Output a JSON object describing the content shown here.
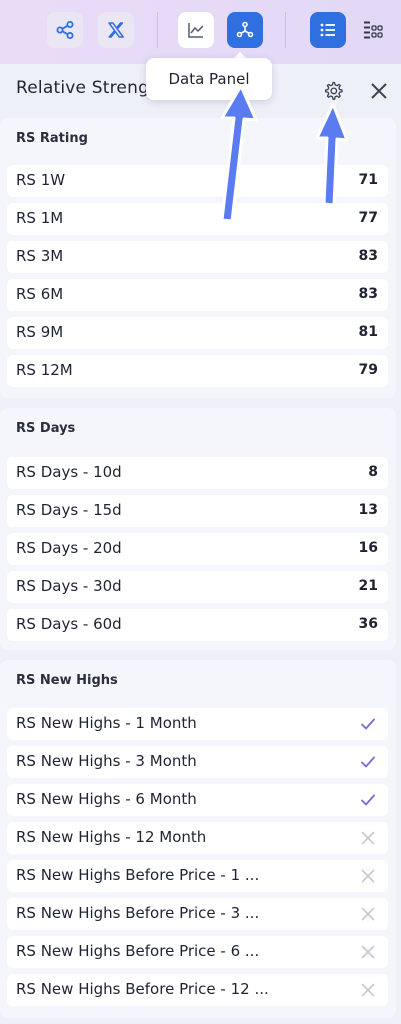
{
  "toolbar": {
    "buttons": [
      {
        "icon": "share-icon"
      },
      {
        "icon": "x-logo-icon"
      },
      {
        "icon": "line-chart-icon"
      },
      {
        "icon": "data-panel-icon",
        "active": true
      },
      {
        "icon": "list-view-icon",
        "active": true
      },
      {
        "icon": "grid-view-icon"
      }
    ]
  },
  "tooltip": "Data Panel",
  "panel": {
    "title": "Relative Streng",
    "settings_icon": "gear-icon",
    "close_icon": "close-icon"
  },
  "sections": {
    "rating": {
      "title": "RS Rating",
      "rows": [
        {
          "label": "RS 1W",
          "value": "71"
        },
        {
          "label": "RS 1M",
          "value": "77"
        },
        {
          "label": "RS 3M",
          "value": "83"
        },
        {
          "label": "RS 6M",
          "value": "83"
        },
        {
          "label": "RS 9M",
          "value": "81"
        },
        {
          "label": "RS 12M",
          "value": "79"
        }
      ]
    },
    "days": {
      "title": "RS Days",
      "rows": [
        {
          "label": "RS Days - 10d",
          "value": "8"
        },
        {
          "label": "RS Days - 15d",
          "value": "13"
        },
        {
          "label": "RS Days - 20d",
          "value": "16"
        },
        {
          "label": "RS Days - 30d",
          "value": "21"
        },
        {
          "label": "RS Days - 60d",
          "value": "36"
        }
      ]
    },
    "highs": {
      "title": "RS New Highs",
      "rows": [
        {
          "label": "RS New Highs - 1 Month",
          "status": "check"
        },
        {
          "label": "RS New Highs - 3 Month",
          "status": "check"
        },
        {
          "label": "RS New Highs - 6 Month",
          "status": "check"
        },
        {
          "label": "RS New Highs - 12 Month",
          "status": "cross"
        },
        {
          "label": "RS New Highs Before Price - 1 ...",
          "status": "cross"
        },
        {
          "label": "RS New Highs Before Price - 3 ...",
          "status": "cross"
        },
        {
          "label": "RS New Highs Before Price - 6 ...",
          "status": "cross"
        },
        {
          "label": "RS New Highs Before Price - 12 ...",
          "status": "cross"
        }
      ]
    }
  },
  "colors": {
    "accent": "#2f6fdf",
    "check": "#7b68d8",
    "cross": "#c5c8d4",
    "annotation_arrow": "#5b7cf0"
  }
}
